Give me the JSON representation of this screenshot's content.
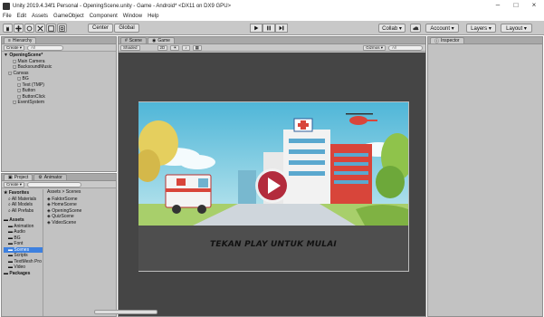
{
  "window": {
    "title": "Unity 2019.4.34f1 Personal - OpeningScene.unity - Game - Android* <DX11 on DX9 GPU>",
    "controls": [
      "–",
      "□",
      "×"
    ]
  },
  "menu": [
    "File",
    "Edit",
    "Assets",
    "GameObject",
    "Component",
    "Window",
    "Help"
  ],
  "toolbar": {
    "center_label": "Center",
    "global_label": "Global",
    "collab_label": "Collab ▾",
    "account_label": "Account ▾",
    "layers_label": "Layers ▾",
    "layout_label": "Layout ▾"
  },
  "hierarchy": {
    "tab_label": "Hierarchy",
    "create_label": "Create ▾",
    "search_placeholder": "All",
    "items": [
      {
        "label": "OpeningScene*",
        "indent": 0,
        "bold": true
      },
      {
        "label": "Main Camera",
        "indent": 2,
        "bold": false
      },
      {
        "label": "BacksoundMusic",
        "indent": 2,
        "bold": false
      },
      {
        "label": "Canvas",
        "indent": 1,
        "bold": false
      },
      {
        "label": "BG",
        "indent": 3,
        "bold": false
      },
      {
        "label": "Text (TMP)",
        "indent": 3,
        "bold": false
      },
      {
        "label": "Button",
        "indent": 3,
        "bold": false
      },
      {
        "label": "ButtonClick",
        "indent": 3,
        "bold": false
      },
      {
        "label": "EventSystem",
        "indent": 2,
        "bold": false
      }
    ]
  },
  "scene_tabs": {
    "scene_label": "Scene",
    "game_label": "Game",
    "shaded_label": "Shaded",
    "mode_label": "2D",
    "gizmos_label": "Gizmos ▾",
    "search_placeholder": "All"
  },
  "inspector": {
    "tab_label": "Inspector"
  },
  "project": {
    "project_tab": "Project",
    "animator_tab": "Animator",
    "create_label": "Create ▾",
    "breadcrumb": "Assets > Scenes",
    "favorites": [
      {
        "label": "Favorites",
        "bold": true
      },
      {
        "label": "All Materials",
        "bold": false
      },
      {
        "label": "All Models",
        "bold": false
      },
      {
        "label": "All Prefabs",
        "bold": false
      }
    ],
    "assets": [
      {
        "label": "Assets",
        "bold": true,
        "sel": false
      },
      {
        "label": "Animation",
        "bold": false,
        "sel": false
      },
      {
        "label": "Audio",
        "bold": false,
        "sel": false
      },
      {
        "label": "BG",
        "bold": false,
        "sel": false
      },
      {
        "label": "Font",
        "bold": false,
        "sel": false
      },
      {
        "label": "Scenes",
        "bold": false,
        "sel": true
      },
      {
        "label": "Scripts",
        "bold": false,
        "sel": false
      },
      {
        "label": "TextMesh Pro",
        "bold": false,
        "sel": false
      },
      {
        "label": "Video",
        "bold": false,
        "sel": false
      },
      {
        "label": "Packages",
        "bold": true,
        "sel": false
      }
    ],
    "scene_files": [
      "FaktorScene",
      "HomeScene",
      "OpeningScene",
      "QuizScene",
      "VideoScene"
    ]
  },
  "game": {
    "banner_text": "TEKAN PLAY UNTUK MULAI"
  },
  "colors": {
    "panel_bg": "#c2c2c2",
    "scene_bg": "#454545",
    "selection": "#3d80df",
    "play_button": "#b32c3d"
  }
}
